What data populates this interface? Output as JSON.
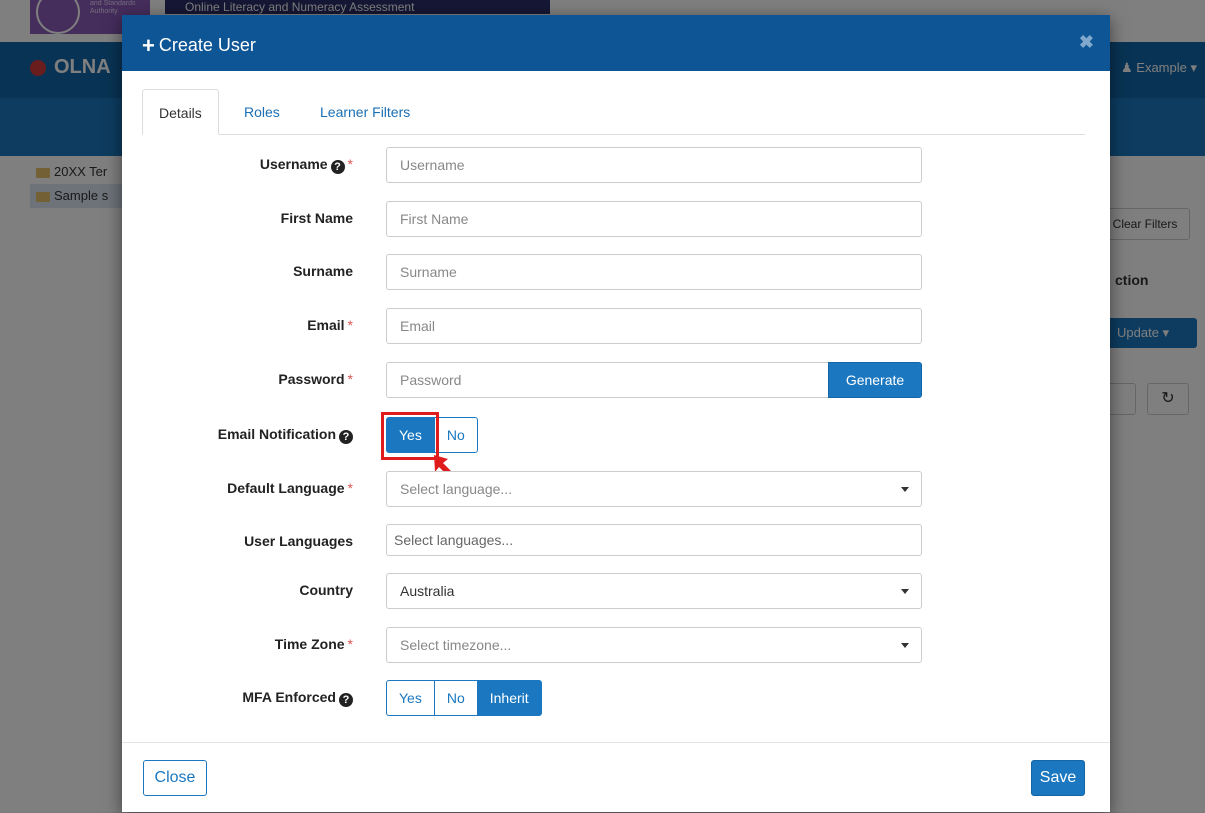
{
  "background": {
    "banner_text": "Online Literacy and Numeracy Assessment",
    "logo_text": "and Standards Authority",
    "brand": "OLNA",
    "user_menu": "Example",
    "tree_items": [
      "20XX Ter",
      "Sample s"
    ],
    "clear_filters": "Clear Filters",
    "action_header": "ction",
    "update_button": "Update"
  },
  "modal": {
    "title": "Create User",
    "tabs": [
      "Details",
      "Roles",
      "Learner Filters"
    ],
    "fields": {
      "username": {
        "label": "Username",
        "placeholder": "Username"
      },
      "first_name": {
        "label": "First Name",
        "placeholder": "First Name"
      },
      "surname": {
        "label": "Surname",
        "placeholder": "Surname"
      },
      "email": {
        "label": "Email",
        "placeholder": "Email"
      },
      "password": {
        "label": "Password",
        "placeholder": "Password",
        "generate": "Generate"
      },
      "email_notification": {
        "label": "Email Notification",
        "options": [
          "Yes",
          "No"
        ],
        "selected": "Yes"
      },
      "default_language": {
        "label": "Default Language",
        "placeholder": "Select language..."
      },
      "user_languages": {
        "label": "User Languages",
        "placeholder": "Select languages..."
      },
      "country": {
        "label": "Country",
        "value": "Australia"
      },
      "time_zone": {
        "label": "Time Zone",
        "placeholder": "Select timezone..."
      },
      "mfa_enforced": {
        "label": "MFA Enforced",
        "options": [
          "Yes",
          "No",
          "Inherit"
        ],
        "selected": "Inherit"
      }
    },
    "required_mark": "*",
    "help_glyph": "?",
    "close_button": "Close",
    "save_button": "Save"
  },
  "colors": {
    "primary": "#1b78c0",
    "header": "#0d5595",
    "required": "#d9534f",
    "highlight": "#e01b1b"
  }
}
